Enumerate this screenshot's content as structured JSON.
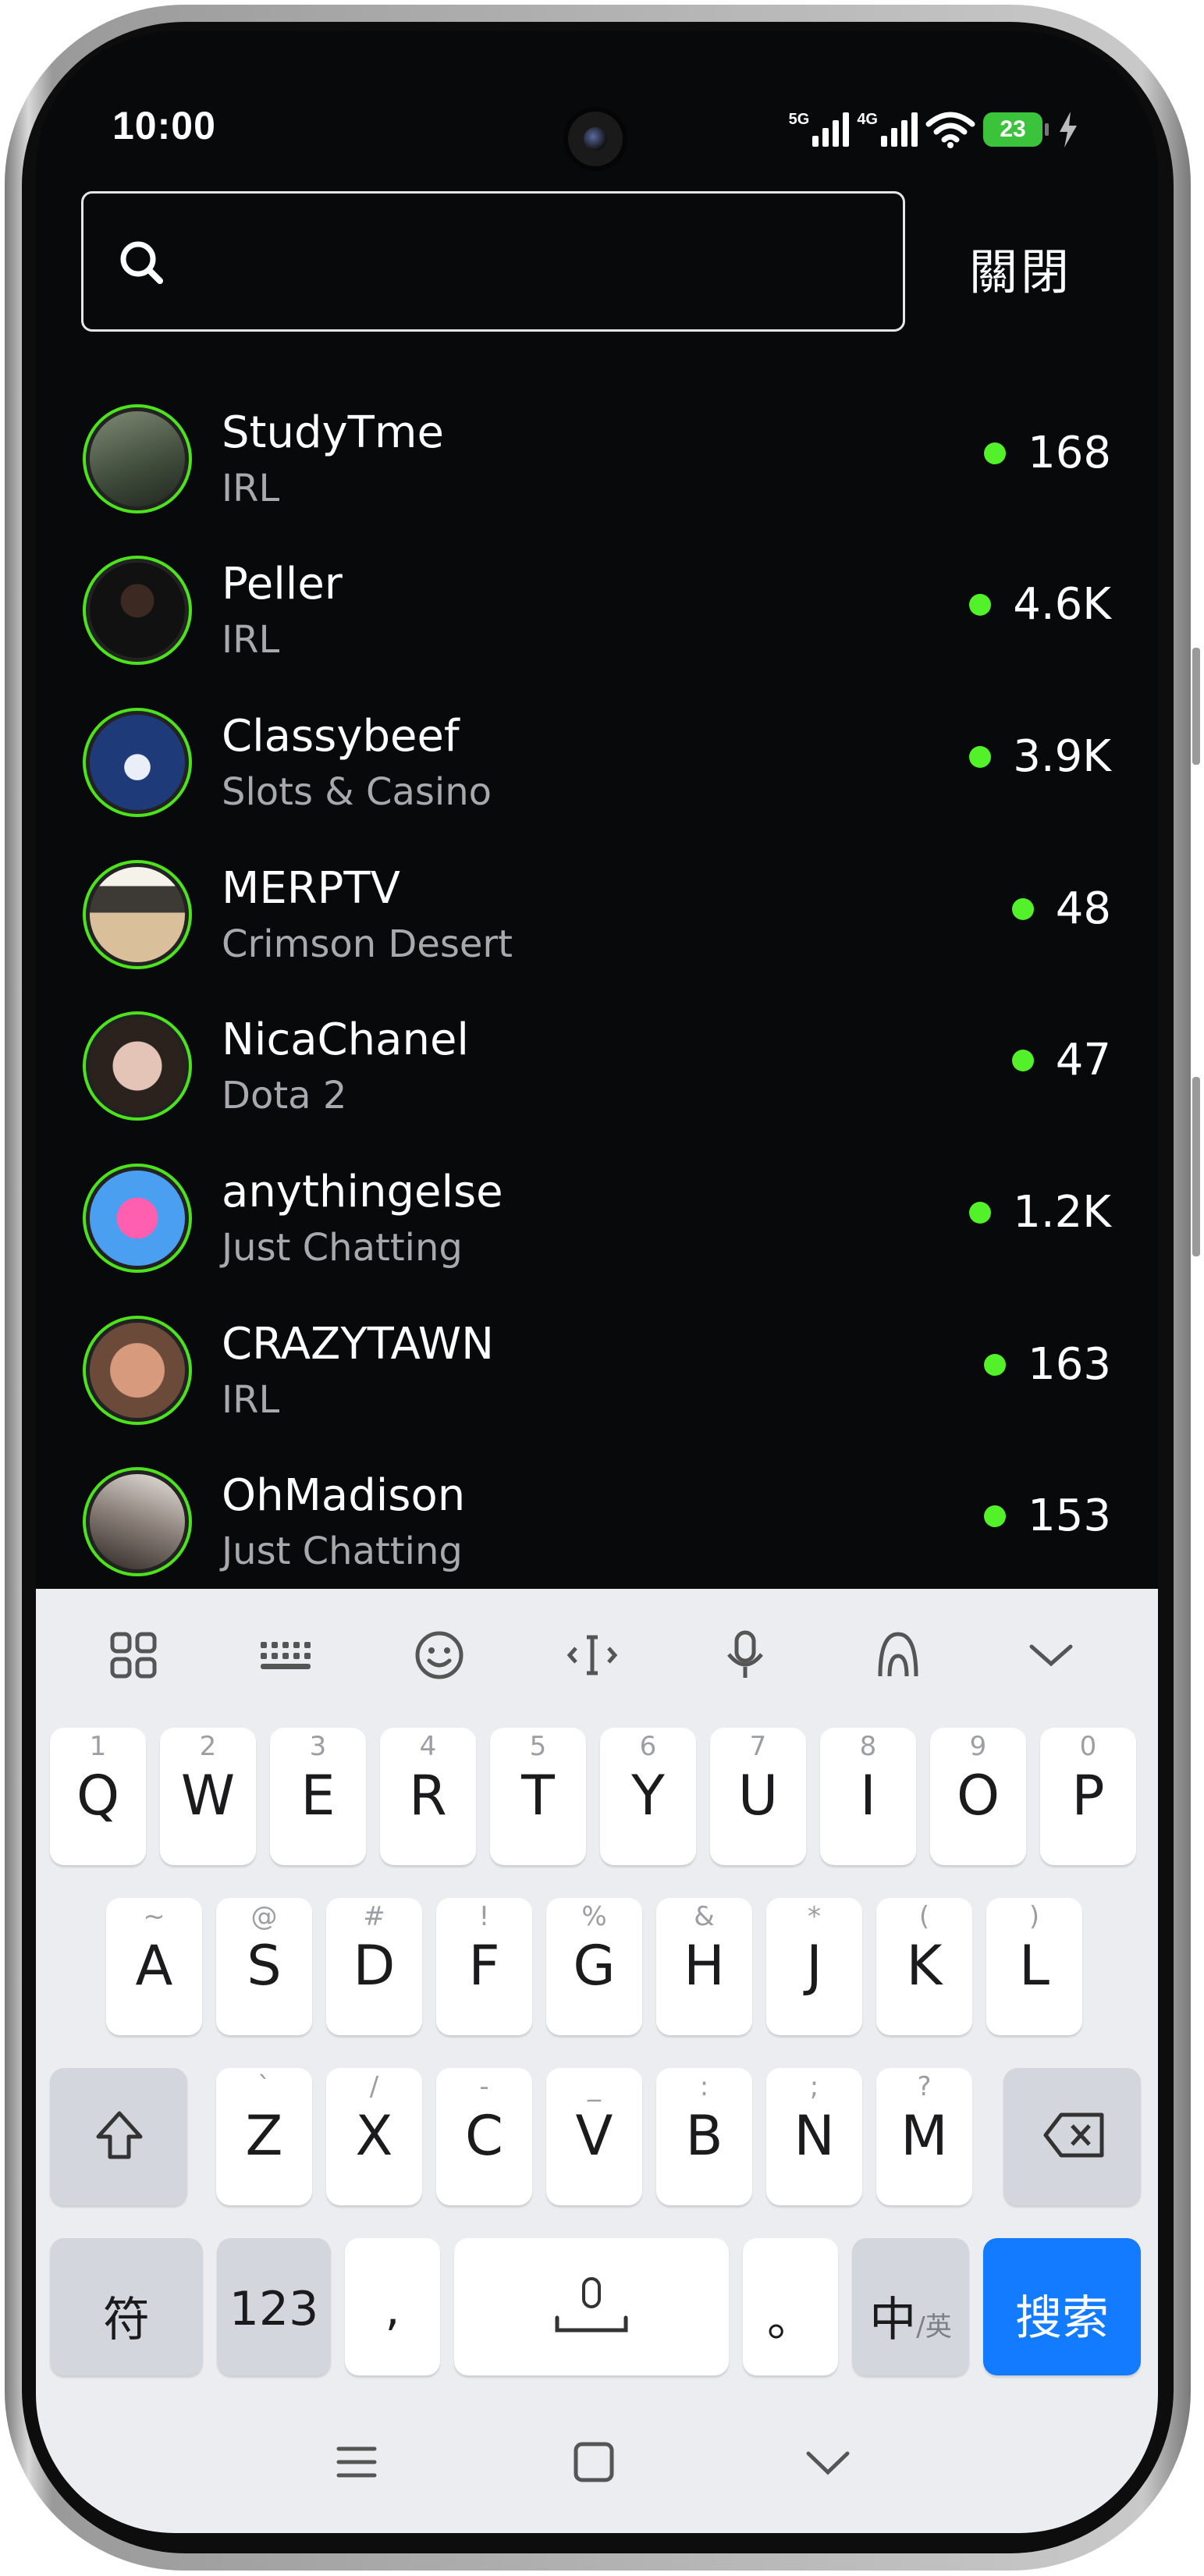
{
  "status_bar": {
    "time": "10:00",
    "net_5g": "5G",
    "net_4g": "4G",
    "battery": "23"
  },
  "search": {
    "placeholder": "",
    "close_label": "關閉"
  },
  "channels": [
    {
      "name": "StudyTme",
      "category": "IRL",
      "viewers": "168"
    },
    {
      "name": "Peller",
      "category": "IRL",
      "viewers": "4.6K"
    },
    {
      "name": "Classybeef",
      "category": "Slots & Casino",
      "viewers": "3.9K"
    },
    {
      "name": "MERPTV",
      "category": "Crimson Desert",
      "viewers": "48"
    },
    {
      "name": "NicaChanel",
      "category": "Dota 2",
      "viewers": "47"
    },
    {
      "name": "anythingelse",
      "category": "Just Chatting",
      "viewers": "1.2K"
    },
    {
      "name": "CRAZYTAWN",
      "category": "IRL",
      "viewers": "163"
    },
    {
      "name": "OhMadison",
      "category": "Just Chatting",
      "viewers": "153"
    }
  ],
  "keyboard": {
    "row1": [
      {
        "key": "Q",
        "hint": "1"
      },
      {
        "key": "W",
        "hint": "2"
      },
      {
        "key": "E",
        "hint": "3"
      },
      {
        "key": "R",
        "hint": "4"
      },
      {
        "key": "T",
        "hint": "5"
      },
      {
        "key": "Y",
        "hint": "6"
      },
      {
        "key": "U",
        "hint": "7"
      },
      {
        "key": "I",
        "hint": "8"
      },
      {
        "key": "O",
        "hint": "9"
      },
      {
        "key": "P",
        "hint": "0"
      }
    ],
    "row2": [
      {
        "key": "A",
        "hint": "~"
      },
      {
        "key": "S",
        "hint": "@"
      },
      {
        "key": "D",
        "hint": "#"
      },
      {
        "key": "F",
        "hint": "!"
      },
      {
        "key": "G",
        "hint": "%"
      },
      {
        "key": "H",
        "hint": "&"
      },
      {
        "key": "J",
        "hint": "*"
      },
      {
        "key": "K",
        "hint": "("
      },
      {
        "key": "L",
        "hint": ")"
      }
    ],
    "row3": [
      {
        "key": "Z",
        "hint": "`"
      },
      {
        "key": "X",
        "hint": "/"
      },
      {
        "key": "C",
        "hint": "-"
      },
      {
        "key": "V",
        "hint": "_"
      },
      {
        "key": "B",
        "hint": ":"
      },
      {
        "key": "N",
        "hint": ";"
      },
      {
        "key": "M",
        "hint": "?"
      }
    ],
    "symbols_label": "符",
    "numbers_label": "123",
    "comma_label": ",",
    "period_label": "。",
    "lang_main": "中",
    "lang_sub": "/英",
    "search_label": "搜索"
  },
  "colors": {
    "live_dot": "#53f12a",
    "avatar_ring": "#4ce21c",
    "search_key": "#137bff",
    "battery": "#3cc33c"
  }
}
